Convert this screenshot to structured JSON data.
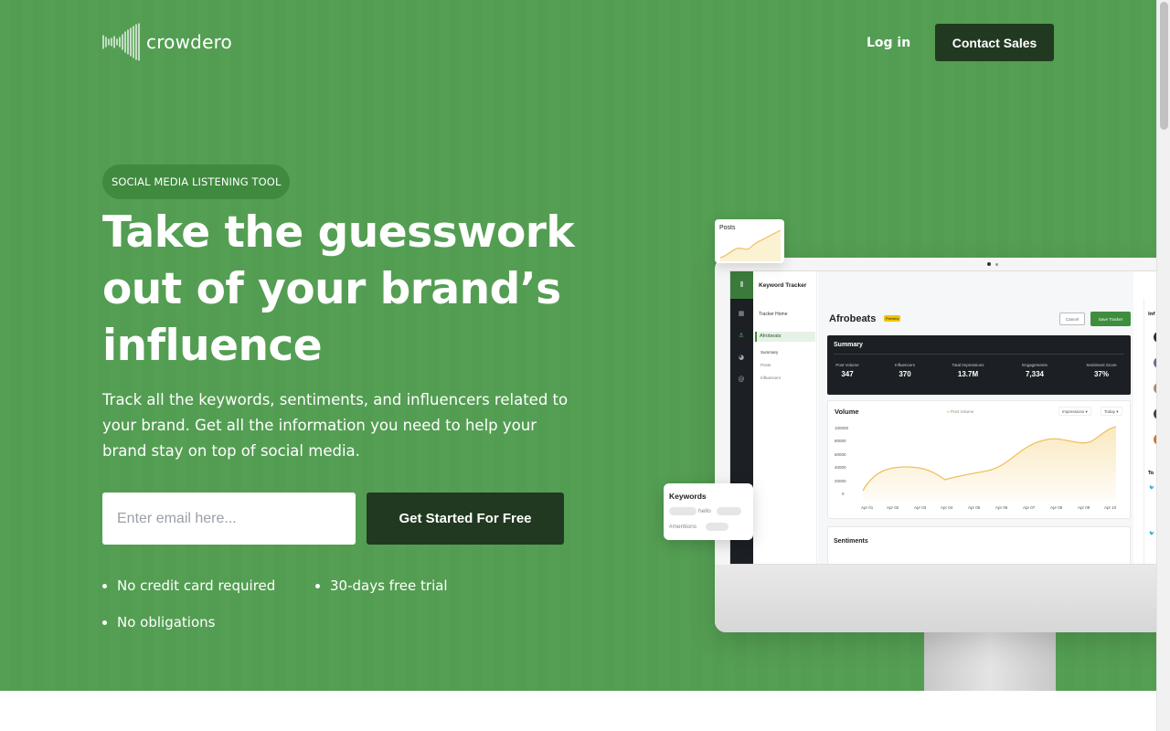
{
  "nav": {
    "logo_text": "crowdero",
    "login_label": "Log in",
    "contact_label": "Contact Sales"
  },
  "hero": {
    "badge": "SOCIAL MEDIA LISTENING TOOL",
    "headline_line1": "Take the guesswork",
    "headline_line2": "out of your brand’s",
    "headline_line3": "influence",
    "subtext": "Track all the keywords, sentiments, and influencers related to your brand. Get all the information you need to help your brand stay on top of social media.",
    "email_placeholder": "Enter email here...",
    "cta_label": "Get Started For Free",
    "bullets": [
      "No credit card required",
      "30-days free trial",
      "No obligations"
    ]
  },
  "mockup": {
    "posts_card_title": "Posts",
    "keywords_card": {
      "title": "Keywords",
      "items": [
        "hello",
        "#mentions"
      ]
    },
    "app": {
      "header": "Keyword Tracker",
      "tracker_home": "Tracker Home",
      "selected": "Afrobeats",
      "sub_items": [
        "Summary",
        "Posts",
        "Influencers"
      ],
      "title": "Afrobeats",
      "preview_tag": "Preview",
      "cancel_label": "Cancel",
      "save_label": "Save Tracker",
      "summary": {
        "title": "Summary",
        "stats": [
          {
            "label": "Post Volume",
            "value": "347"
          },
          {
            "label": "Influencers",
            "value": "370"
          },
          {
            "label": "Total Impressions",
            "value": "13.7M"
          },
          {
            "label": "Engagements",
            "value": "7,334"
          },
          {
            "label": "Sentiment Score",
            "value": "37%"
          }
        ]
      },
      "volume": {
        "title": "Volume",
        "legend": "Post Volume",
        "dropdown1": "Impressions ▾",
        "dropdown2": "Today ▾",
        "y_ticks": [
          "100000",
          "80000",
          "60000",
          "40000",
          "20000",
          "0"
        ],
        "x_ticks": [
          "Apr 01",
          "Apr 02",
          "Apr 03",
          "Apr 04",
          "Apr 05",
          "Apr 06",
          "Apr 07",
          "Apr 08",
          "Apr 09",
          "Apr 10"
        ]
      },
      "sentiments_title": "Sentiments",
      "right_panel_labels": [
        "Inf",
        "To"
      ]
    }
  },
  "colors": {
    "hero_bg": "#549f53",
    "dark_green": "#213921",
    "chart_line": "#f0c060"
  }
}
